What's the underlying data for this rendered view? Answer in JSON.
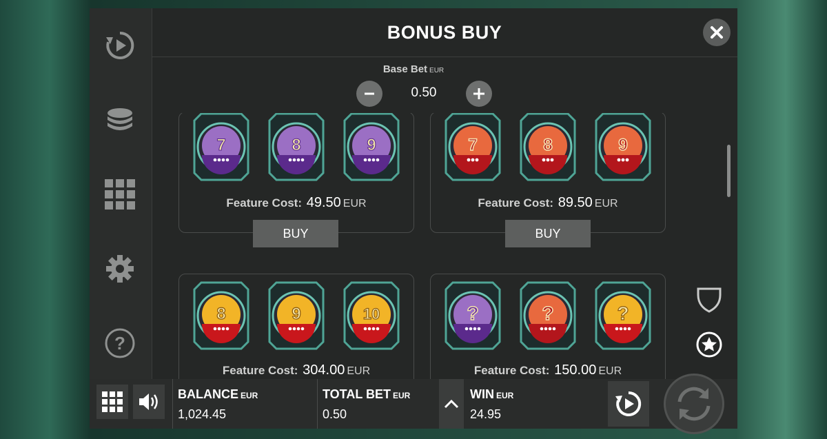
{
  "header": {
    "title": "BONUS BUY"
  },
  "base_bet": {
    "label": "Base Bet",
    "currency": "EUR",
    "value": "0.50"
  },
  "features": [
    {
      "symbols": [
        "7",
        "8",
        "9"
      ],
      "theme": "purple",
      "cost_label": "Feature Cost:",
      "cost": "49.50",
      "currency": "EUR",
      "buy_label": "BUY"
    },
    {
      "symbols": [
        "7",
        "8",
        "9"
      ],
      "theme": "red",
      "cost_label": "Feature Cost:",
      "cost": "89.50",
      "currency": "EUR",
      "buy_label": "BUY"
    },
    {
      "symbols": [
        "8",
        "9",
        "10"
      ],
      "theme": "gold",
      "cost_label": "Feature Cost:",
      "cost": "304.00",
      "currency": "EUR"
    },
    {
      "symbols": [
        "?",
        "?",
        "?"
      ],
      "theme": "mixed",
      "cost_label": "Feature Cost:",
      "cost": "150.00",
      "currency": "EUR"
    }
  ],
  "sidebar": {
    "icons": [
      "autoplay-icon",
      "chips-icon",
      "paytable-grid-icon",
      "settings-gear-icon",
      "help-icon"
    ]
  },
  "right_icons": [
    "shield-icon",
    "star-icon"
  ],
  "footer": {
    "balance": {
      "label": "BALANCE",
      "currency": "EUR",
      "value": "1,024.45"
    },
    "total_bet": {
      "label": "TOTAL BET",
      "currency": "EUR",
      "value": "0.50"
    },
    "win": {
      "label": "WIN",
      "currency": "EUR",
      "value": "24.95"
    }
  },
  "colors": {
    "panel": "#252726",
    "button": "#5d5f5e",
    "accent_teal": "#3f8f84"
  }
}
